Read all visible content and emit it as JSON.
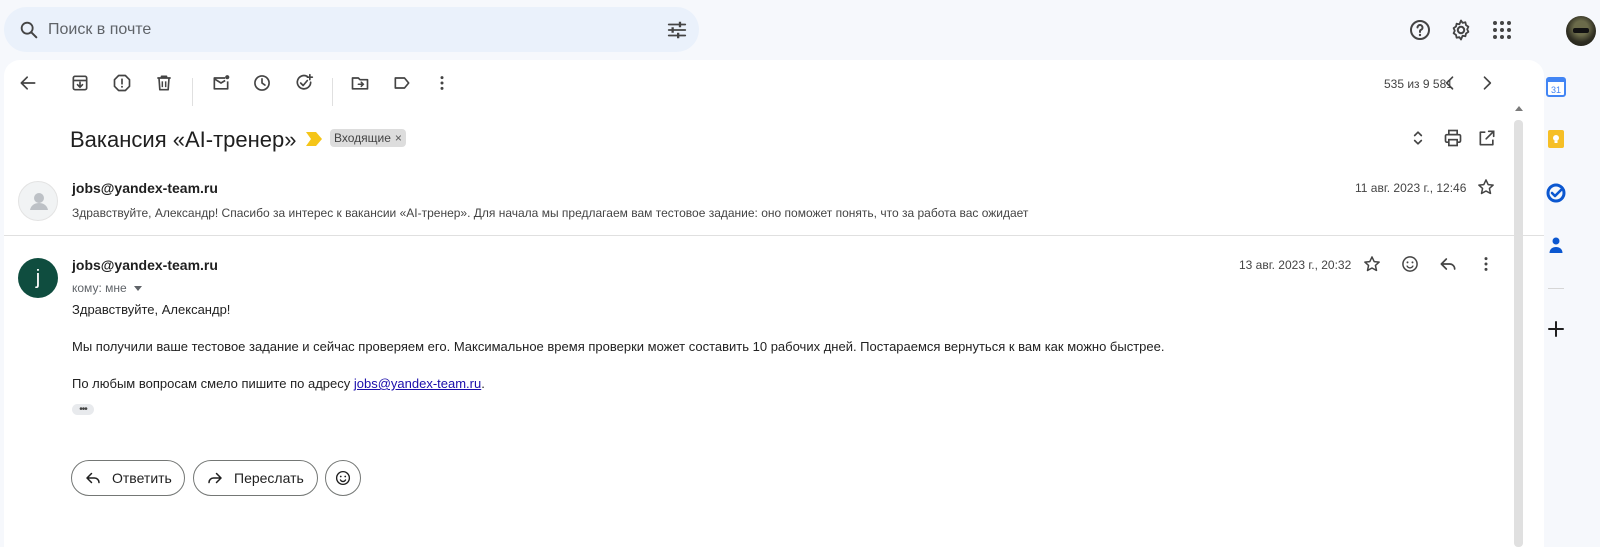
{
  "search": {
    "placeholder": "Поиск в почте"
  },
  "toolbar": {
    "counter": "535 из 9 581"
  },
  "thread": {
    "subject": "Вакансия «AI-тренер»",
    "label": "Входящие",
    "label_remove": "×"
  },
  "message1": {
    "sender": "jobs@yandex-team.ru",
    "date": "11 авг. 2023 г., 12:46",
    "snippet": "Здравствуйте, Александр! Спасибо за интерес к вакансии «AI-тренер». Для начала мы предлагаем вам тестовое задание: оно поможет понять, что за работа вас ожидает"
  },
  "message2": {
    "avatar_letter": "j",
    "sender": "jobs@yandex-team.ru",
    "to": "кому: мне",
    "date": "13 авг. 2023 г., 20:32",
    "greeting": "Здравствуйте, Александр!",
    "paragraph1": "Мы получили ваше тестовое задание и сейчас проверяем его. Максимальное время проверки может составить 10 рабочих дней. Постараемся вернуться к вам как можно быстрее.",
    "paragraph2_prefix": "По любым вопросам смело пишите по адресу ",
    "paragraph2_link": "jobs@yandex-team.ru",
    "paragraph2_suffix": ".",
    "trimmed": "•••"
  },
  "actions": {
    "reply": "Ответить",
    "forward": "Переслать"
  },
  "sidebar": {
    "calendar_day": "31"
  },
  "colors": {
    "accent_blue": "#0b57d0",
    "avatar_green": "#0f4d3f",
    "keep_yellow": "#f6bf26",
    "important_yellow": "#f5c518"
  }
}
